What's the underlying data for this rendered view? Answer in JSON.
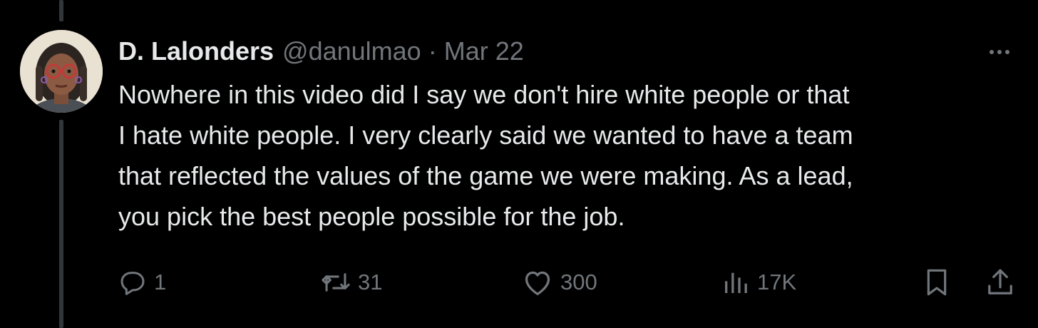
{
  "tweet": {
    "author": {
      "display_name": "D. Lalonders",
      "handle": "@danulmao",
      "avatar_icon": "avatar-illustration"
    },
    "separator": "·",
    "date": "Mar 22",
    "text": "Nowhere in this video did I say we don't hire white people or that\nI hate white people. I very clearly said we wanted to have a team\nthat reflected the values of the game we were making. As a lead,\nyou pick the best people possible for the job.",
    "actions": {
      "replies": "1",
      "retweets": "31",
      "likes": "300",
      "views": "17K"
    }
  },
  "colors": {
    "background": "#000000",
    "primary_text": "#e7e9ea",
    "secondary_text": "#71767b",
    "thread_line": "#333639"
  }
}
